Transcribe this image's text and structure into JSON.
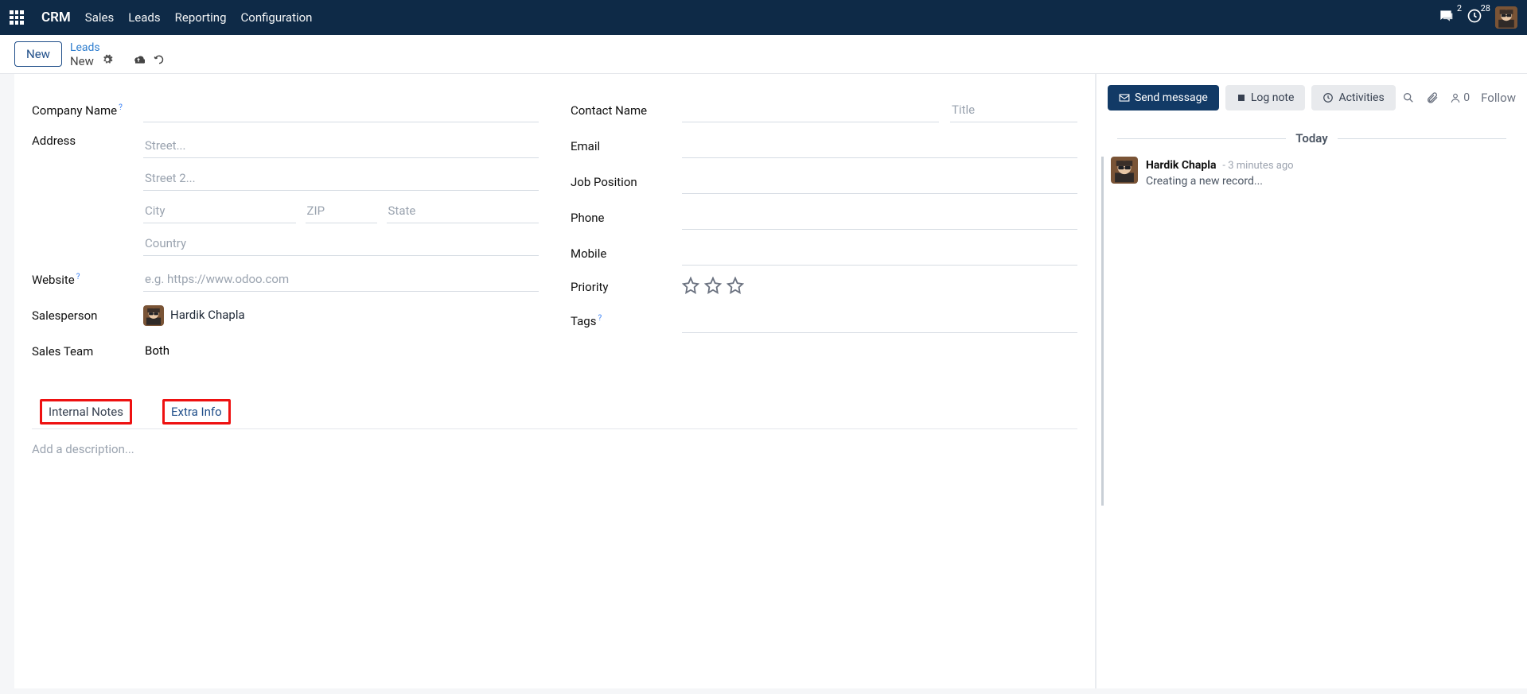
{
  "nav": {
    "brand": "CRM",
    "items": [
      "Sales",
      "Leads",
      "Reporting",
      "Configuration"
    ],
    "chat_count": "2",
    "clock_count": "28"
  },
  "subhead": {
    "new_btn": "New",
    "breadcrumb_top": "Leads",
    "breadcrumb_current": "New"
  },
  "form": {
    "company_name_label": "Company Name",
    "address_label": "Address",
    "street_ph": "Street...",
    "street2_ph": "Street 2...",
    "city_ph": "City",
    "zip_ph": "ZIP",
    "state_ph": "State",
    "country_ph": "Country",
    "website_label": "Website",
    "website_ph": "e.g. https://www.odoo.com",
    "salesperson_label": "Salesperson",
    "salesperson_value": "Hardik Chapla",
    "salesteam_label": "Sales Team",
    "salesteam_value": "Both",
    "contact_name_label": "Contact Name",
    "title_ph": "Title",
    "email_label": "Email",
    "job_label": "Job Position",
    "phone_label": "Phone",
    "mobile_label": "Mobile",
    "priority_label": "Priority",
    "tags_label": "Tags"
  },
  "tabs": {
    "internal_notes": "Internal Notes",
    "extra_info": "Extra Info",
    "desc_ph": "Add a description..."
  },
  "chatter": {
    "send": "Send message",
    "log": "Log note",
    "activities": "Activities",
    "follower_count": "0",
    "follow": "Follow",
    "today": "Today",
    "msg_author": "Hardik Chapla",
    "msg_time": "- 3 minutes ago",
    "msg_text": "Creating a new record..."
  }
}
